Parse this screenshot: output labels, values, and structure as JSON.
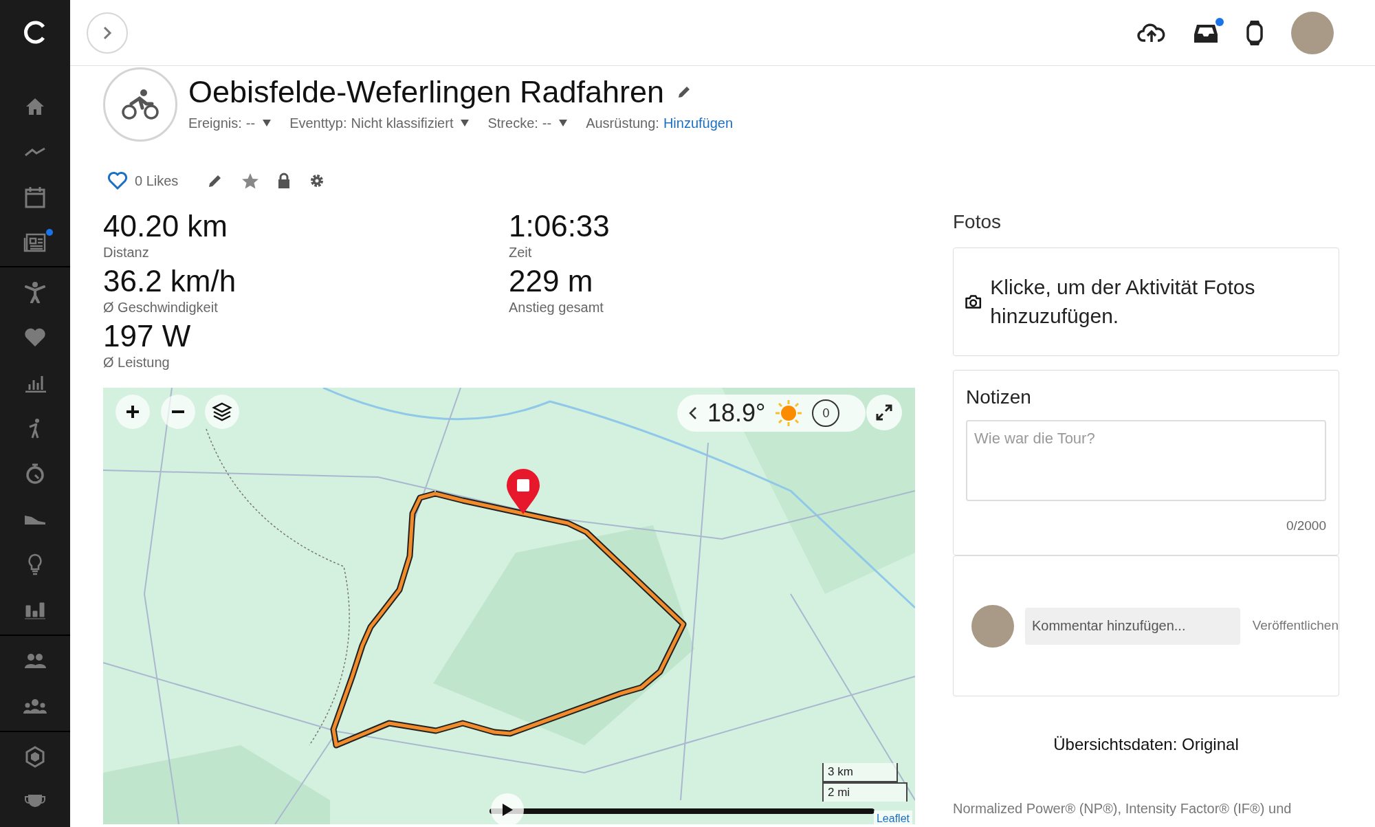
{
  "sidebar": {
    "news_notification": true
  },
  "header": {
    "inbox_notification": true
  },
  "activity": {
    "title": "Oebisfelde-Weferlingen Radfahren",
    "meta": [
      {
        "kind": "dropdown",
        "label": "Ereignis:",
        "value": "--"
      },
      {
        "kind": "dropdown",
        "label": "Eventtyp:",
        "value": "Nicht klassifiziert"
      },
      {
        "kind": "dropdown",
        "label": "Strecke:",
        "value": "--"
      },
      {
        "kind": "link",
        "label": "Ausrüstung:",
        "value": "Hinzufügen"
      }
    ],
    "likes": {
      "label": "0 Likes",
      "liked": false
    }
  },
  "stats": [
    {
      "value": "40.20 km",
      "label": "Distanz"
    },
    {
      "value": "1:06:33",
      "label": "Zeit"
    },
    {
      "value": "36.2 km/h",
      "label": "Ø Geschwindigkeit"
    },
    {
      "value": "229 m",
      "label": "Anstieg gesamt"
    },
    {
      "value": "197 W",
      "label": "Ø Leistung"
    }
  ],
  "map": {
    "temperature": "18.9°",
    "timer_count": "0",
    "scale": [
      "3 km",
      "2 mi"
    ],
    "attribution": "Leaflet"
  },
  "photos": {
    "heading": "Fotos",
    "prompt": "Klicke, um der Aktivität Fotos hinzuzufügen."
  },
  "notes": {
    "heading": "Notizen",
    "placeholder": "Wie war die Tour?",
    "counter": "0/2000"
  },
  "comment": {
    "placeholder": "Kommentar hinzufügen...",
    "publish": "Veröffentlichen"
  },
  "summary": {
    "title": "Übersichtsdaten: Original",
    "footnote": "Normalized Power® (NP®), Intensity Factor® (IF®) und"
  }
}
